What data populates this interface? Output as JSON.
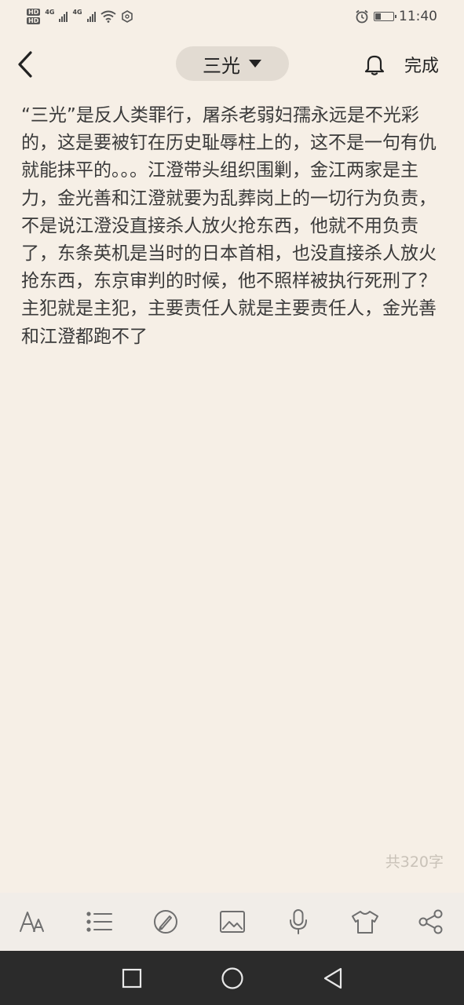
{
  "status_bar": {
    "time": "11:40",
    "hd1": "HD",
    "hd2": "HD",
    "net1": "4G",
    "net2": "4G",
    "battery_level": 0.3,
    "icons": [
      "hd-icon",
      "signal-icon",
      "wifi-icon",
      "nfc-icon",
      "alarm-icon",
      "battery-icon"
    ]
  },
  "header": {
    "back_icon": "chevron-left-icon",
    "title": "三光",
    "title_dropdown_icon": "caret-down-icon",
    "reminder_icon": "bell-icon",
    "done_label": "完成"
  },
  "note": {
    "content": "“三光”是反人类罪行，屠杀老弱妇孺永远是不光彩的，这是要被钉在历史耻辱柱上的，这不是一句有仇就能抹平的。。。江澄带头组织围剿，金江两家是主力，金光善和江澄就要为乱葬岗上的一切行为负责，不是说江澄没直接杀人放火抢东西，他就不用负责了，东条英机是当时的日本首相，也没直接杀人放火抢东西，东京审判的时候，他不照样被执行死刑了？主犯就是主犯，主要责任人就是主要责任人，金光善和江澄都跑不了",
    "char_count": "共320字"
  },
  "toolbar": {
    "items": [
      "text-style-icon",
      "list-icon",
      "sketch-icon",
      "image-icon",
      "microphone-icon",
      "theme-shirt-icon",
      "share-icon"
    ]
  },
  "navbar": {
    "items": [
      "recent-apps-icon",
      "home-icon",
      "back-triangle-icon"
    ]
  },
  "colors": {
    "background": "#f6efe6",
    "title_pill": "#e2dbd2",
    "toolbar_bg": "#f1ede8",
    "navbar_bg": "#2b2b2b",
    "text": "#3a3a3a",
    "muted": "#c9c2b8"
  }
}
